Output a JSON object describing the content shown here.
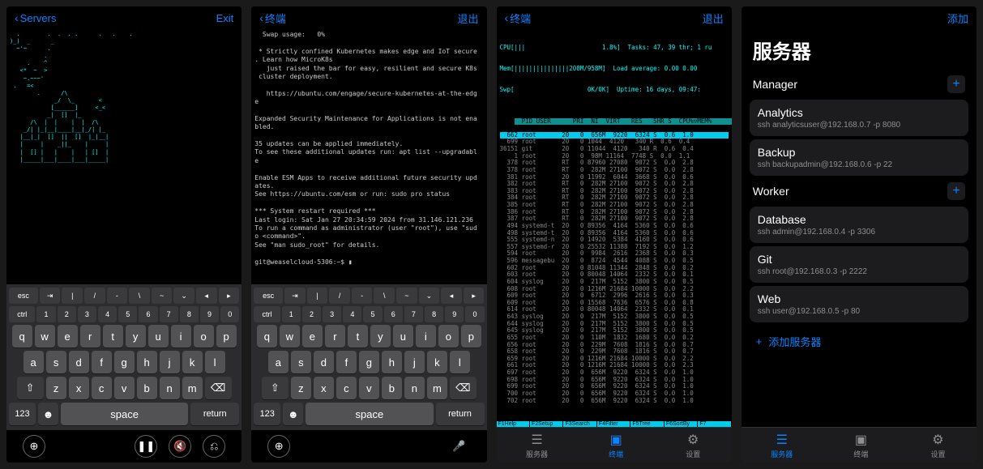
{
  "screen1": {
    "back_label": "Servers",
    "exit_label": "Exit",
    "ascii_lines": [
      "  .        .  .  . .      .   .    .",
      ")_)  _      _                      ",
      "  ~'~      .",
      "          .",
      "     .    ^",
      "   <*  ~  >",
      "    ~.~~~'",
      " .   =<",
      "        .      /\\",
      "             _/  \\_       <",
      "            [______]     <_<",
      "           _|  []  |_",
      "      /\\  |  |    |  |  /\\",
      "    _/| |_|__|____|__|_/| |_",
      "   |__|_|  []  ||  []  |_|__|",
      "   |     |    _||_    |     |",
      "   |  [] |   |    |   | []  |",
      "   |_____|___|____|___|_____|"
    ],
    "accessory_row1": [
      "esc",
      "⇥",
      "|",
      "/",
      "-",
      "\\",
      "~",
      "⌄",
      "◂",
      "▸"
    ],
    "accessory_row2": [
      "ctrl",
      "1",
      "2",
      "3",
      "4",
      "5",
      "6",
      "7",
      "8",
      "9",
      "0"
    ],
    "keys_row1": [
      "q",
      "w",
      "e",
      "r",
      "t",
      "y",
      "u",
      "i",
      "o",
      "p"
    ],
    "keys_row2": [
      "a",
      "s",
      "d",
      "f",
      "g",
      "h",
      "j",
      "k",
      "l"
    ],
    "keys_row3": [
      "z",
      "x",
      "c",
      "v",
      "b",
      "n",
      "m"
    ],
    "num_key": "123",
    "space_label": "space",
    "return_label": "return"
  },
  "screen2": {
    "back_label": "终端",
    "exit_label": "退出",
    "terminal_lines": [
      "  Swap usage:   0%",
      "",
      " * Strictly confined Kubernetes makes edge and IoT secure",
      ". Learn how MicroK8s",
      "   just raised the bar for easy, resilient and secure K8s",
      " cluster deployment.",
      "",
      "   https://ubuntu.com/engage/secure-kubernetes-at-the-edg",
      "e",
      "",
      "Expanded Security Maintenance for Applications is not ena",
      "bled.",
      "",
      "35 updates can be applied immediately.",
      "To see these additional updates run: apt list --upgradabl",
      "e",
      "",
      "Enable ESM Apps to receive additional future security upd",
      "ates.",
      "See https://ubuntu.com/esm or run: sudo pro status",
      "",
      "*** System restart required ***",
      "Last login: Sat Jan 27 20:34:59 2024 from 31.146.121.236",
      "To run a command as administrator (user \"root\"), use \"sud",
      "o <command>\".",
      "See \"man sudo_root\" for details.",
      "",
      "git@weaselcloud-5306:~$ ▮"
    ]
  },
  "screen3": {
    "back_label": "终端",
    "exit_label": "退出",
    "cpu_line": "CPU[|||                     1.8%]",
    "mem_line": "Mem[|||||||||||||||208M/958M]",
    "swp_line": "Swp[                    0K/0K]",
    "tasks": "Tasks: 47, 39 thr; 1 ru",
    "loadavg": "Load average: 0.00 0.00",
    "uptime": "Uptime: 16 days, 09:47:",
    "col_head": "  PID USER      PRI  NI  VIRT   RES   SHR S  CPU%▽MEM%",
    "rows": [
      "  662 root       20   0  656M  9220  6324 S  0.6  1.0",
      "  699 root       20   0 1044  4120   340 R  0.6  0.4",
      "36151 git        20   0 11044  4120   340 R  0.6  0.4",
      "    1 root       20   0  98M 11164  7748 S  0.0  1.1",
      "  378 root       RT   0 87960 27080  9072 S  0.0  2.8",
      "  378 root       RT   0  282M 27100  9072 S  0.0  2.8",
      "  381 root       20   0 11992  6044  3668 S  0.0  0.6",
      "  382 root       RT   0  282M 27100  9072 S  0.0  2.8",
      "  383 root       RT   0  282M 27100  9072 S  0.0  2.8",
      "  384 root       RT   0  282M 27100  9072 S  0.0  2.8",
      "  385 root       RT   0  282M 27100  9072 S  0.0  2.8",
      "  386 root       RT   0  282M 27100  9072 S  0.0  2.8",
      "  387 root       RT   0  282M 27100  9072 S  0.0  2.8",
      "  494 systemd-t  20   0 89356  4164  5360 S  0.0  0.6",
      "  498 systemd-t  20   0 89356  4164  5360 S  0.0  0.6",
      "  555 systemd-n  20   0 14920  5384  4160 S  0.0  0.6",
      "  557 systemd-r  20   0 25532 11388  7192 S  0.0  1.2",
      "  594 root       20   0  9984  2616  2368 S  0.0  0.3",
      "  596 messagebu  20   0  8724  4544  4088 S  0.0  0.5",
      "  602 root       20   0 81048 11344  2848 S  0.0  0.2",
      "  603 root       20   0 80048 14064  2332 S  0.0  0.1",
      "  604 syslog     20   0  217M  5152  3800 S  0.0  0.5",
      "  608 root       20   0 1216M 21684 10000 S  0.0  2.2",
      "  609 root       20   0  6712  2996  2616 S  0.0  0.3",
      "  609 root       20   0 15568  7636  6576 S  0.0  0.8",
      "  614 root       20   0 80048 14064  2332 S  0.0  0.1",
      "  643 syslog     20   0  217M  5152  3800 S  0.0  0.5",
      "  644 syslog     20   0  217M  5152  3800 S  0.0  0.5",
      "  645 syslog     20   0  217M  5152  3800 S  0.0  0.5",
      "  655 root       20   0  110M  1832  1680 S  0.0  0.2",
      "  656 root       20   0  229M  7608  1816 S  0.0  0.7",
      "  658 root       20   0  229M  7608  1816 S  0.0  0.7",
      "  659 root       20   0 1216M 21684 10000 S  0.0  2.2",
      "  661 root       20   0 1216M 21684 10000 S  0.0  2.3",
      "  697 root       20   0  656M  9220  6324 S  0.0  1.0",
      "  698 root       20   0  656M  9220  6324 S  0.0  1.0",
      "  699 root       20   0  656M  9220  6324 S  0.0  1.0",
      "  700 root       20   0  656M  9220  6324 S  0.0  1.0",
      "  702 root       20   0  656M  9220  6324 S  0.0  1.0"
    ],
    "fkeys": [
      "F1Help",
      "F2Setup",
      "F3Search",
      "F4Filter",
      "F5Tree",
      "F6SortBy",
      "F7"
    ],
    "tabs": {
      "servers": "服务器",
      "terminal": "终端",
      "settings": "设置"
    }
  },
  "screen4": {
    "add_label": "添加",
    "page_title": "服务器",
    "sections": [
      {
        "name": "Manager",
        "items": [
          {
            "title": "Analytics",
            "sub": "ssh analyticsuser@192.168.0.7 -p 8080"
          },
          {
            "title": "Backup",
            "sub": "ssh backupadmin@192.168.0.6 -p 22"
          }
        ]
      },
      {
        "name": "Worker",
        "items": [
          {
            "title": "Database",
            "sub": "ssh admin@192.168.0.4 -p 3306"
          },
          {
            "title": "Git",
            "sub": "ssh root@192.168.0.3 -p 2222"
          },
          {
            "title": "Web",
            "sub": "ssh user@192.168.0.5 -p 80"
          }
        ]
      }
    ],
    "add_server": "添加服务器",
    "tabs": {
      "servers": "服务器",
      "terminal": "终端",
      "settings": "设置"
    }
  }
}
